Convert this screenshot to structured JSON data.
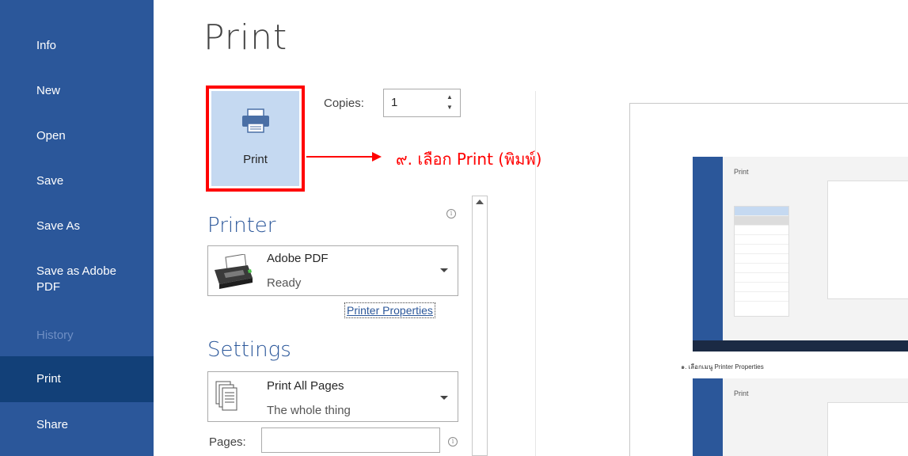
{
  "sidebar": {
    "items": [
      {
        "label": "Info"
      },
      {
        "label": "New"
      },
      {
        "label": "Open"
      },
      {
        "label": "Save"
      },
      {
        "label": "Save As"
      },
      {
        "label": "Save as Adobe PDF"
      },
      {
        "label": "History"
      },
      {
        "label": "Print"
      },
      {
        "label": "Share"
      }
    ]
  },
  "page": {
    "title": "Print"
  },
  "print_button": {
    "label": "Print"
  },
  "copies": {
    "label": "Copies:",
    "value": "1"
  },
  "annotation": {
    "text": "๙. เลือก Print (พิมพ์)"
  },
  "printer": {
    "section_title": "Printer",
    "name": "Adobe PDF",
    "status": "Ready",
    "properties_link": "Printer Properties"
  },
  "settings": {
    "section_title": "Settings",
    "pages_option": "Print All Pages",
    "pages_option_desc": "The whole thing",
    "pages_label": "Pages:",
    "pages_value": ""
  },
  "preview": {
    "caption": "๑. เลือกเมนู Printer Properties",
    "shot_title": "Print"
  },
  "colors": {
    "sidebar_bg": "#2b579a",
    "sidebar_active": "#124078",
    "accent": "#2b579a",
    "highlight_red": "#ff0000"
  }
}
